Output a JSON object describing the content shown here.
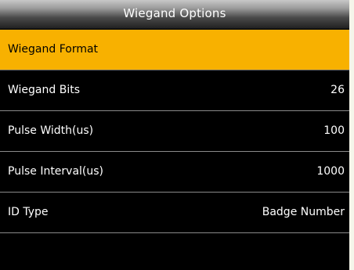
{
  "header": {
    "title": "Wiegand Options"
  },
  "menu": {
    "items": [
      {
        "label": "Wiegand Format",
        "value": ""
      },
      {
        "label": "Wiegand Bits",
        "value": "26"
      },
      {
        "label": "Pulse Width(us)",
        "value": "100"
      },
      {
        "label": "Pulse Interval(us)",
        "value": "1000"
      },
      {
        "label": "ID Type",
        "value": "Badge Number"
      }
    ],
    "selected_index": 0
  },
  "colors": {
    "selected_bg": "#f8b100",
    "background": "#000000",
    "text": "#ffffff"
  }
}
